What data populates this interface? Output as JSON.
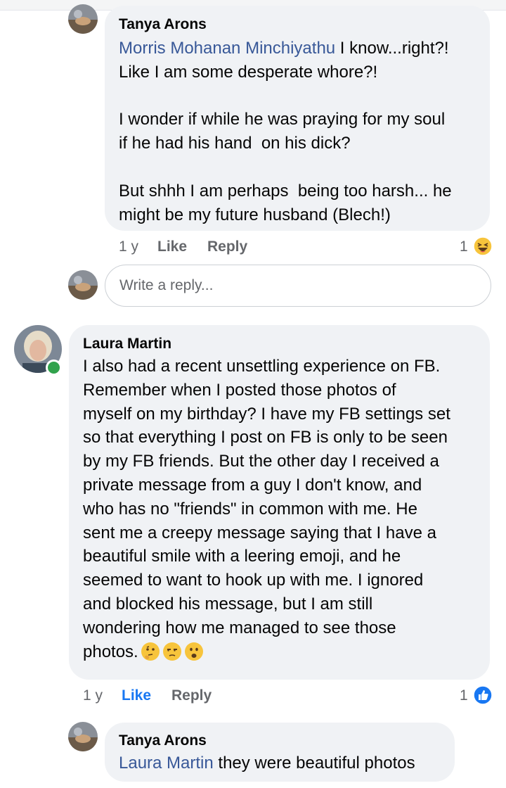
{
  "comments": [
    {
      "author": "Tanya Arons",
      "mention": "Morris Mohanan Minchiyathu",
      "text": " I know...right?!\nLike I am some desperate whore?!\n\nI wonder if while he was praying for my soul\nif he had his hand  on his dick?\n\nBut shhh I am perhaps  being too harsh... he\nmight be my future husband (Blech!)",
      "time": "1 y",
      "like": "Like",
      "reply": "Reply",
      "reaction_count": "1",
      "reaction_icon": "laughing-emoji-icon"
    },
    {
      "author": "Laura Martin",
      "text": "I also had a recent unsettling experience on FB.\nRemember when I posted those photos of\nmyself on my birthday? I have my FB settings set\nso that everything I post on FB is only to be seen\nby my FB friends. But the other day I received a\nprivate message from a guy I don't know, and\nwho has no \"friends\" in common with me. He\nsent me a creepy message saying that I have a\nbeautiful smile with a leering emoji, and he\nseemed to want to hook up with me. I ignored\nand blocked his message, but I am still\nwondering how me managed to see those\nphotos.",
      "emojis": [
        "thinking-face-icon",
        "unamused-face-icon",
        "frowning-face-icon"
      ],
      "time": "1 y",
      "like": "Like",
      "reply": "Reply",
      "reaction_count": "1",
      "reaction_icon": "thumbs-up-reaction-icon",
      "online": true
    },
    {
      "author": "Tanya Arons",
      "mention": "Laura Martin",
      "text": " they were beautiful photos"
    }
  ],
  "reply_input": {
    "placeholder": "Write a reply..."
  },
  "colors": {
    "bubble": "#f0f2f5",
    "mention": "#385898",
    "like_active": "#1877f2",
    "meta": "#65676b",
    "online": "#31a24c"
  }
}
